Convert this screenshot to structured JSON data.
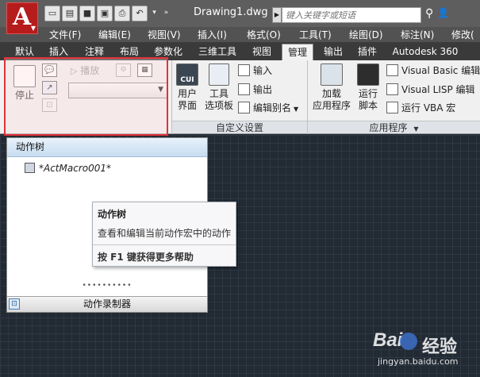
{
  "titlebar": {
    "document_title": "Drawing1.dwg",
    "search_placeholder": "键入关键字或短语",
    "app_icon_letter": "A",
    "qat_icons": [
      "new-icon",
      "open-icon",
      "save-icon",
      "save-as-icon",
      "print-icon",
      "undo-icon",
      "redo-icon",
      "more-icon"
    ]
  },
  "menubar": {
    "items": [
      "文件(F)",
      "编辑(E)",
      "视图(V)",
      "插入(I)",
      "格式(O)",
      "工具(T)",
      "绘图(D)",
      "标注(N)",
      "修改("
    ]
  },
  "tabs": {
    "items": [
      "默认",
      "插入",
      "注释",
      "布局",
      "参数化",
      "三维工具",
      "视图",
      "管理",
      "输出",
      "插件",
      "Autodesk 360"
    ],
    "active": "管理"
  },
  "ribbon": {
    "recorder": {
      "stop_label": "停止",
      "play_label": "播放",
      "dropdown_value": ""
    },
    "customize": {
      "user_interface_label": "用户\n界面",
      "cui_icon_text": "CUI",
      "tool_palettes_label": "工具\n选项板",
      "import_label": "输入",
      "export_label": "输出",
      "edit_aliases_label": "编辑别名",
      "panel_title": "自定义设置"
    },
    "applications": {
      "load_app_label": "加载\n应用程序",
      "run_script_label": "运行\n脚本",
      "vba_editor_label": "Visual Basic 编辑",
      "lisp_editor_label": "Visual LISP 编辑",
      "run_vba_label": "运行 VBA 宏",
      "panel_title": "应用程序"
    }
  },
  "action_panel": {
    "header": "动作树",
    "macro_name": "*ActMacro001*",
    "footer": "动作录制器"
  },
  "tooltip": {
    "title": "动作树",
    "description": "查看和编辑当前动作宏中的动作",
    "help": "按 F1 键获得更多帮助"
  },
  "watermark": {
    "brand": "Bai",
    "brand_suffix": "经验",
    "url": "jingyan.baidu.com"
  },
  "colors": {
    "app_red": "#b61c1c",
    "highlight_border": "#e0323a",
    "drawing_bg": "#222a33"
  }
}
